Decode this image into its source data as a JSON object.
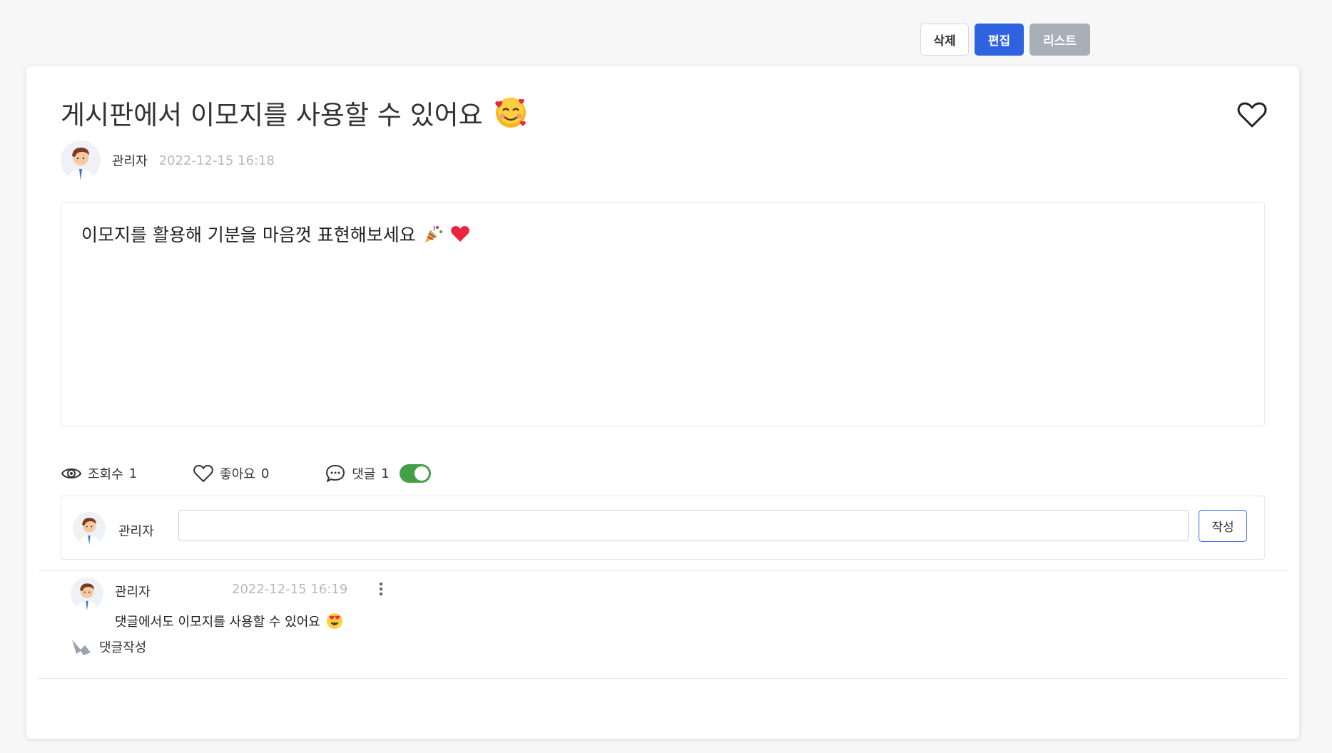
{
  "actions": {
    "delete_label": "삭제",
    "edit_label": "편집",
    "list_label": "리스트"
  },
  "post": {
    "title": "게시판에서 이모지를 사용할 수 있어요",
    "title_emoji": "smiling-face-with-hearts",
    "author": "관리자",
    "date": "2022-12-15 16:18",
    "content": "이모지를 활용해 기분을 마음껏 표현해보세요",
    "content_emojis": [
      "party-popper",
      "red-heart"
    ]
  },
  "stats": {
    "views_label": "조회수",
    "views": "1",
    "likes_label": "좋아요",
    "likes": "0",
    "comments_label": "댓글",
    "comments": "1",
    "comments_toggle_on": true
  },
  "comment_form": {
    "author": "관리자",
    "input_value": "",
    "submit_label": "작성"
  },
  "comments": [
    {
      "author": "관리자",
      "date": "2022-12-15 16:19",
      "text": "댓글에서도 이모지를 사용할 수 있어요",
      "emoji": "heart-eyes-face",
      "reply_label": "댓글작성"
    }
  ],
  "colors": {
    "primary": "#2f62de",
    "secondary": "#a9afb9",
    "toggle_on": "#43a047"
  }
}
